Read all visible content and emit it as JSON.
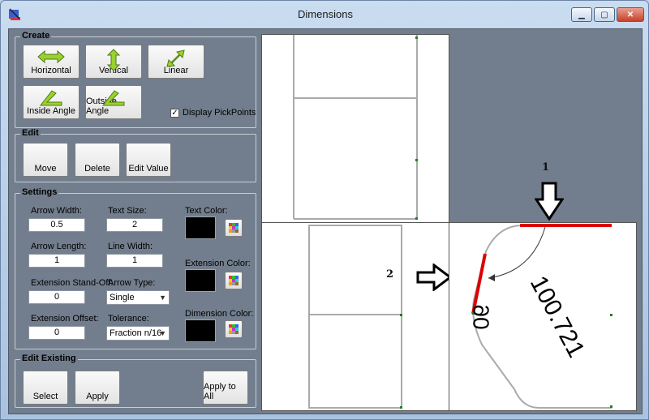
{
  "window": {
    "title": "Dimensions"
  },
  "create": {
    "title": "Create",
    "horizontal": "Horizontal",
    "vertical": "Vertical",
    "linear": "Linear",
    "inside_angle": "Inside Angle",
    "outside_angle": "Outside Angle",
    "display_pickpoints": "Display PickPoints",
    "display_pickpoints_checked": true
  },
  "edit": {
    "title": "Edit",
    "move": "Move",
    "delete": "Delete",
    "edit_value": "Edit Value"
  },
  "settings": {
    "title": "Settings",
    "arrow_width_label": "Arrow Width:",
    "arrow_width": "0.5",
    "text_size_label": "Text Size:",
    "text_size": "2",
    "arrow_length_label": "Arrow Length:",
    "arrow_length": "1",
    "line_width_label": "Line Width:",
    "line_width": "1",
    "ext_standoff_label": "Extension Stand-Off:",
    "ext_standoff": "0",
    "arrow_type_label": "Arrow Type:",
    "arrow_type": "Single",
    "ext_offset_label": "Extension Offset:",
    "ext_offset": "0",
    "tolerance_label": "Tolerance:",
    "tolerance": "Fraction n/16",
    "text_color_label": "Text Color:",
    "extension_color_label": "Extension Color:",
    "dimension_color_label": "Dimension Color:",
    "text_color": "#000000",
    "extension_color": "#000000",
    "dimension_color": "#000000"
  },
  "edit_existing": {
    "title": "Edit Existing",
    "select": "Select",
    "apply": "Apply",
    "apply_all": "Apply to All"
  },
  "viewport": {
    "annotation_1": "1",
    "annotation_2": "2",
    "dimension_value": "100.721",
    "angle_value": "90"
  }
}
